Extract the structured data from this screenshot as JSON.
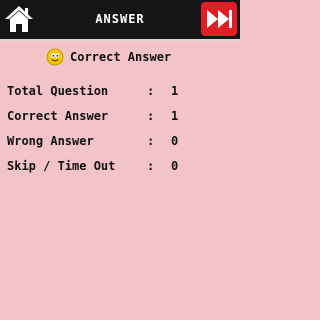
{
  "header": {
    "title": "ANSWER",
    "home_icon": "home-icon",
    "next_icon": "fast-forward-icon",
    "colors": {
      "bar": "#151515",
      "next_button": "#e11d25"
    }
  },
  "result": {
    "title": "Correct Answer",
    "icon": "smiley-icon",
    "stats": [
      {
        "label": "Total Question",
        "sep": ":",
        "value": "1"
      },
      {
        "label": "Correct Answer",
        "sep": ":",
        "value": "1"
      },
      {
        "label": "Wrong Answer",
        "sep": ":",
        "value": "0"
      },
      {
        "label": "Skip / Time Out",
        "sep": ":",
        "value": "0"
      }
    ]
  },
  "colors": {
    "background": "#f2c3c8"
  }
}
